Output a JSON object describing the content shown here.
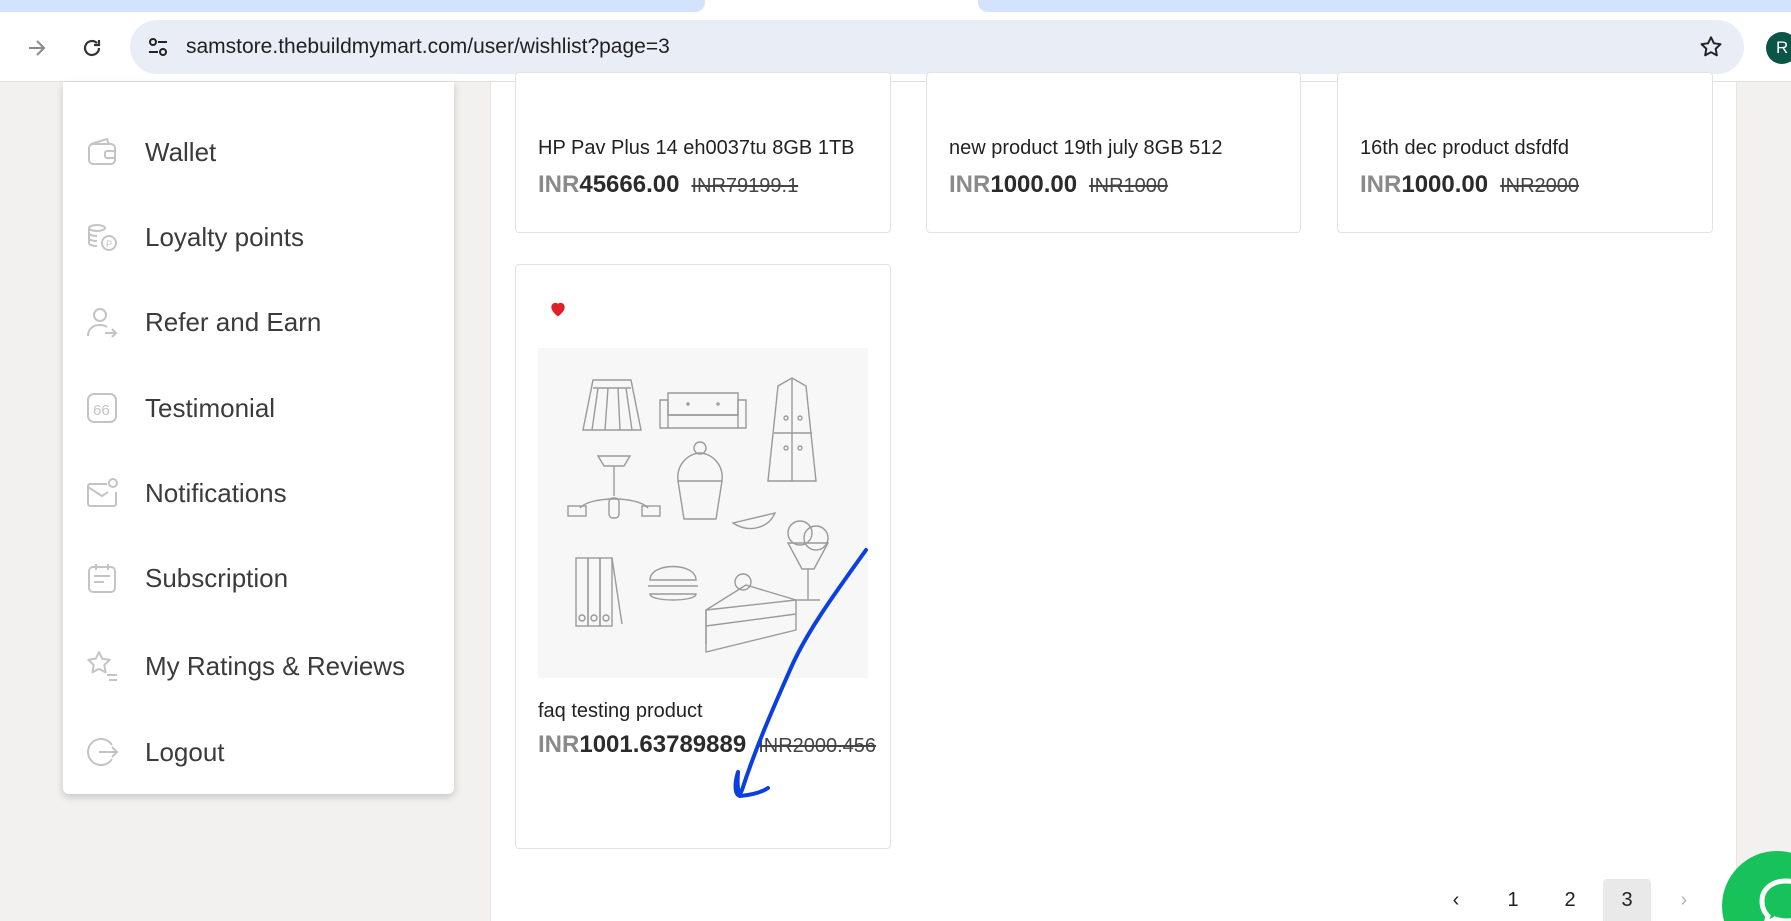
{
  "browser": {
    "url": "samstore.thebuildmymart.com/user/wishlist?page=3",
    "profile_initial": "R",
    "icons": [
      "forward-icon",
      "reload-icon",
      "site-settings-icon",
      "bookmark-star-icon"
    ]
  },
  "sidebar": {
    "items": [
      {
        "label": "Wallet",
        "icon": "wallet-icon"
      },
      {
        "label": "Loyalty points",
        "icon": "coins-icon"
      },
      {
        "label": "Refer and Earn",
        "icon": "refer-user-icon"
      },
      {
        "label": "Testimonial",
        "icon": "quote-icon"
      },
      {
        "label": "Notifications",
        "icon": "mail-notification-icon"
      },
      {
        "label": "Subscription",
        "icon": "subscription-icon"
      },
      {
        "label": "My Ratings & Reviews",
        "icon": "star-rating-icon"
      },
      {
        "label": "Logout",
        "icon": "logout-icon"
      }
    ]
  },
  "products": [
    {
      "name": "HP Pav Plus 14 eh0037tu 8GB 1TB",
      "currency": "INR",
      "price": "45666.00",
      "old_price": "INR79199.1"
    },
    {
      "name": "new product 19th july 8GB 512",
      "currency": "INR",
      "price": "1000.00",
      "old_price": "INR1000"
    },
    {
      "name": "16th dec product dsfdfd",
      "currency": "INR",
      "price": "1000.00",
      "old_price": "INR2000"
    },
    {
      "name": "faq testing product",
      "currency": "INR",
      "price": "1001.63789889",
      "old_price": "INR2000.456"
    }
  ],
  "pagination": {
    "prev": "‹",
    "pages": [
      "1",
      "2",
      "3"
    ],
    "current": "3",
    "next": "›"
  },
  "colors": {
    "accent_green": "#17c25b",
    "heart_red": "#e01f26",
    "annotation_blue": "#0a3fe0"
  }
}
